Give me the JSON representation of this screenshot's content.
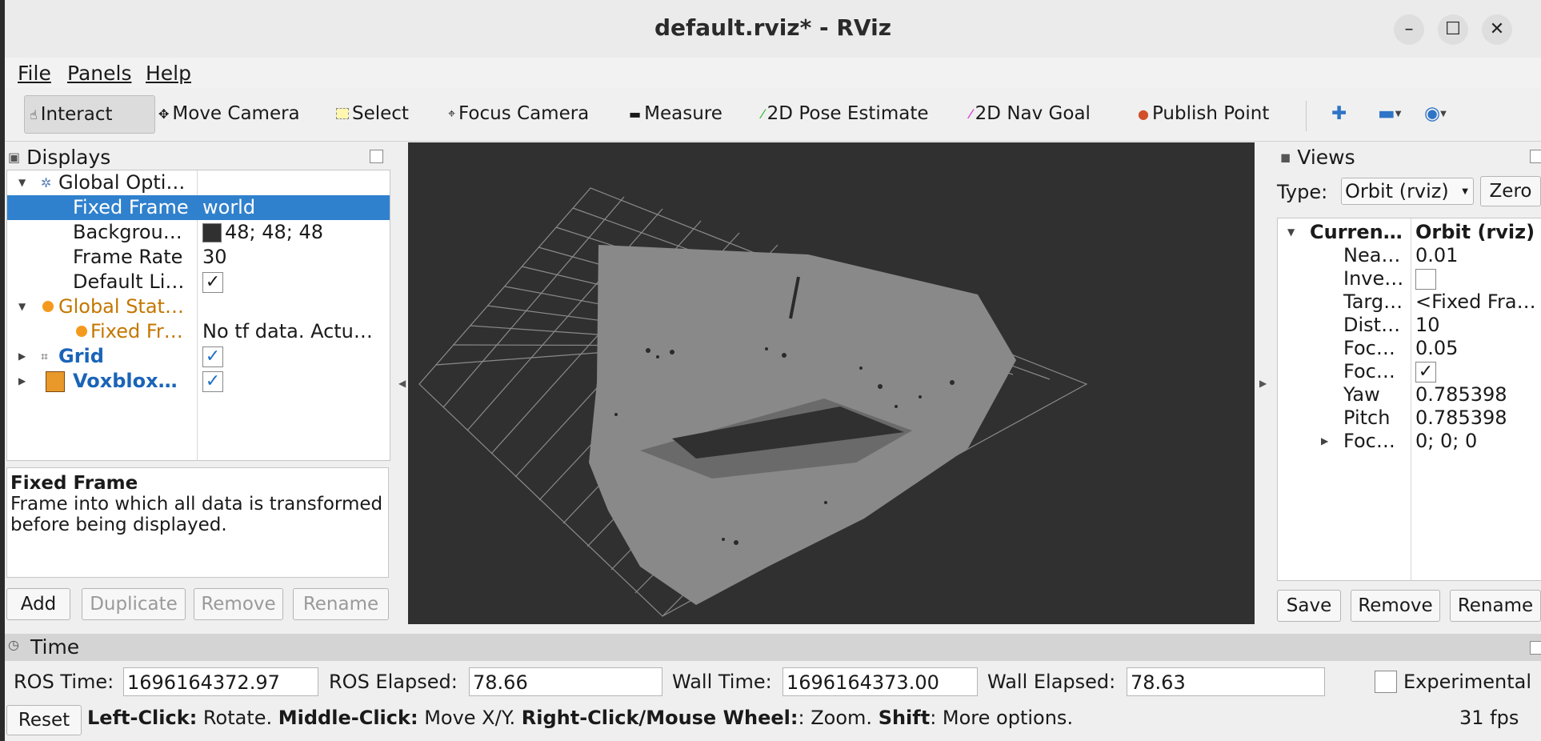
{
  "window": {
    "title": "default.rviz* - RViz"
  },
  "menu": {
    "file": "File",
    "panels": "Panels",
    "help": "Help"
  },
  "toolbar": {
    "interact": "Interact",
    "move_camera": "Move Camera",
    "select": "Select",
    "focus_camera": "Focus Camera",
    "measure": "Measure",
    "pose_estimate": "2D Pose Estimate",
    "nav_goal": "2D Nav Goal",
    "publish_point": "Publish Point"
  },
  "displays": {
    "title": "Displays",
    "rows": [
      {
        "name": "Global Opti…",
        "value": ""
      },
      {
        "name": "Fixed Frame",
        "value": "world"
      },
      {
        "name": "Backgrou…",
        "value": "48; 48; 48"
      },
      {
        "name": "Frame Rate",
        "value": "30"
      },
      {
        "name": "Default Li…",
        "value": "✓"
      },
      {
        "name": "Global Stat…",
        "value": ""
      },
      {
        "name": "Fixed Fr…",
        "value": "No tf data.  Actu…"
      },
      {
        "name": "Grid",
        "value": "✓"
      },
      {
        "name": "Voxblox…",
        "value": "✓"
      }
    ],
    "background_color": "#303030",
    "description_title": "Fixed Frame",
    "description_text": "Frame into which all data is transformed before being displayed.",
    "buttons": {
      "add": "Add",
      "duplicate": "Duplicate",
      "remove": "Remove",
      "rename": "Rename"
    }
  },
  "views": {
    "title": "Views",
    "type_label": "Type:",
    "type_value": "Orbit (rviz)",
    "zero": "Zero",
    "rows": [
      {
        "name": "Curren…",
        "value": "Orbit (rviz)"
      },
      {
        "name": "Nea…",
        "value": "0.01"
      },
      {
        "name": "Inve…",
        "value": ""
      },
      {
        "name": "Targ…",
        "value": "<Fixed Fra…"
      },
      {
        "name": "Dist…",
        "value": "10"
      },
      {
        "name": "Foc…",
        "value": "0.05"
      },
      {
        "name": "Foc…",
        "value": "✓"
      },
      {
        "name": "Yaw",
        "value": "0.785398"
      },
      {
        "name": "Pitch",
        "value": "0.785398"
      },
      {
        "name": "Foc…",
        "value": "0; 0; 0"
      }
    ],
    "buttons": {
      "save": "Save",
      "remove": "Remove",
      "rename": "Rename"
    }
  },
  "time": {
    "title": "Time",
    "ros_time_label": "ROS Time:",
    "ros_time": "1696164372.97",
    "ros_elapsed_label": "ROS Elapsed:",
    "ros_elapsed": "78.66",
    "wall_time_label": "Wall Time:",
    "wall_time": "1696164373.00",
    "wall_elapsed_label": "Wall Elapsed:",
    "wall_elapsed": "78.63",
    "experimental": "Experimental"
  },
  "status": {
    "reset": "Reset",
    "left_click": "Left-Click:",
    "rotate": " Rotate. ",
    "middle_click": "Middle-Click:",
    "move": " Move X/Y. ",
    "right_click": "Right-Click/Mouse Wheel:",
    "zoom": ": Zoom. ",
    "shift": "Shift",
    "more": ": More options.",
    "fps": "31 fps"
  }
}
